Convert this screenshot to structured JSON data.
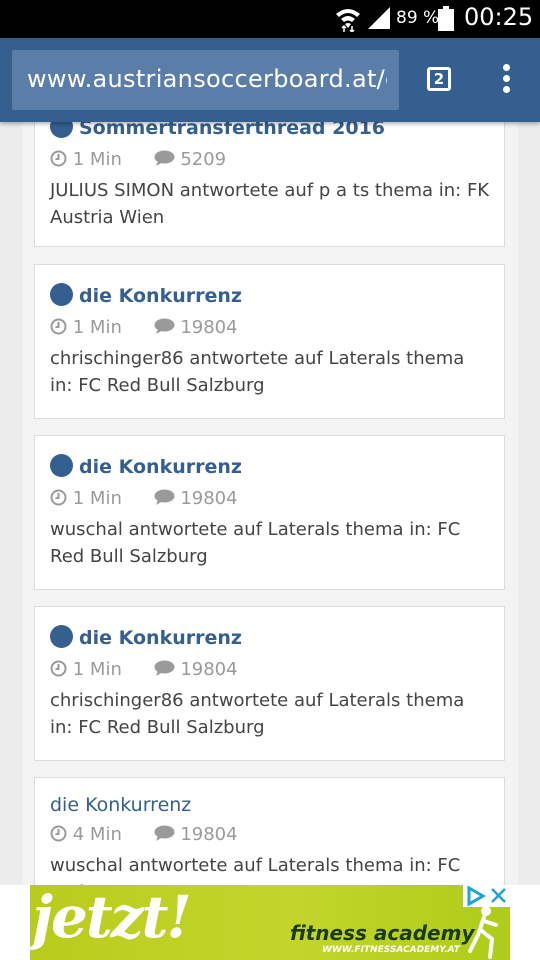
{
  "status_bar": {
    "battery_percent": "89 %",
    "time": "00:25"
  },
  "browser": {
    "url": "www.austriansoccerboard.at/c",
    "tab_count": "2"
  },
  "feed": {
    "items": [
      {
        "title": "Sommertransferthread 2016",
        "time": "1 Min",
        "replies": "5209",
        "text": "JULIUS SIMON antwortete auf p a ts thema in: FK Austria Wien",
        "unread": true
      },
      {
        "title": "die Konkurrenz",
        "time": "1 Min",
        "replies": "19804",
        "text": "chrischinger86 antwortete auf Laterals thema in: FC Red Bull Salzburg",
        "unread": true
      },
      {
        "title": "die Konkurrenz",
        "time": "1 Min",
        "replies": "19804",
        "text": "wuschal antwortete auf Laterals thema in: FC Red Bull Salzburg",
        "unread": true
      },
      {
        "title": "die Konkurrenz",
        "time": "1 Min",
        "replies": "19804",
        "text": "chrischinger86 antwortete auf Laterals thema in: FC Red Bull Salzburg",
        "unread": true
      },
      {
        "title": "die Konkurrenz",
        "time": "4 Min",
        "replies": "19804",
        "text": "wuschal antwortete auf Laterals thema in: FC Red",
        "unread": false
      }
    ]
  },
  "ad": {
    "headline": "jetzt!",
    "brand": "fitness academy",
    "url": "WWW.FITNESSACADEMY.AT"
  },
  "colors": {
    "toolbar": "#355f8e",
    "link": "#355f8e",
    "ad_green": "#c3d52b"
  }
}
